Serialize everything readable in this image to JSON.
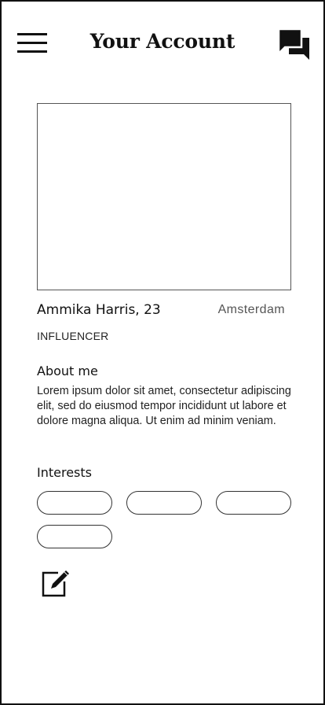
{
  "header": {
    "title": "Your Account",
    "menu_icon": "hamburger-menu-icon",
    "chat_icon": "chat-bubbles-icon"
  },
  "profile": {
    "name_age": "Ammika Harris, 23",
    "location": "Amsterdam",
    "role": "INFLUENCER"
  },
  "about": {
    "title": "About me",
    "text": "Lorem ipsum dolor sit amet, consectetur adipiscing elit, sed do eiusmod tempor incididunt ut labore et dolore magna aliqua. Ut enim ad minim veniam."
  },
  "interests": {
    "title": "Interests",
    "chips": [
      "",
      "",
      "",
      ""
    ]
  },
  "actions": {
    "edit_icon": "edit-pencil-icon"
  }
}
